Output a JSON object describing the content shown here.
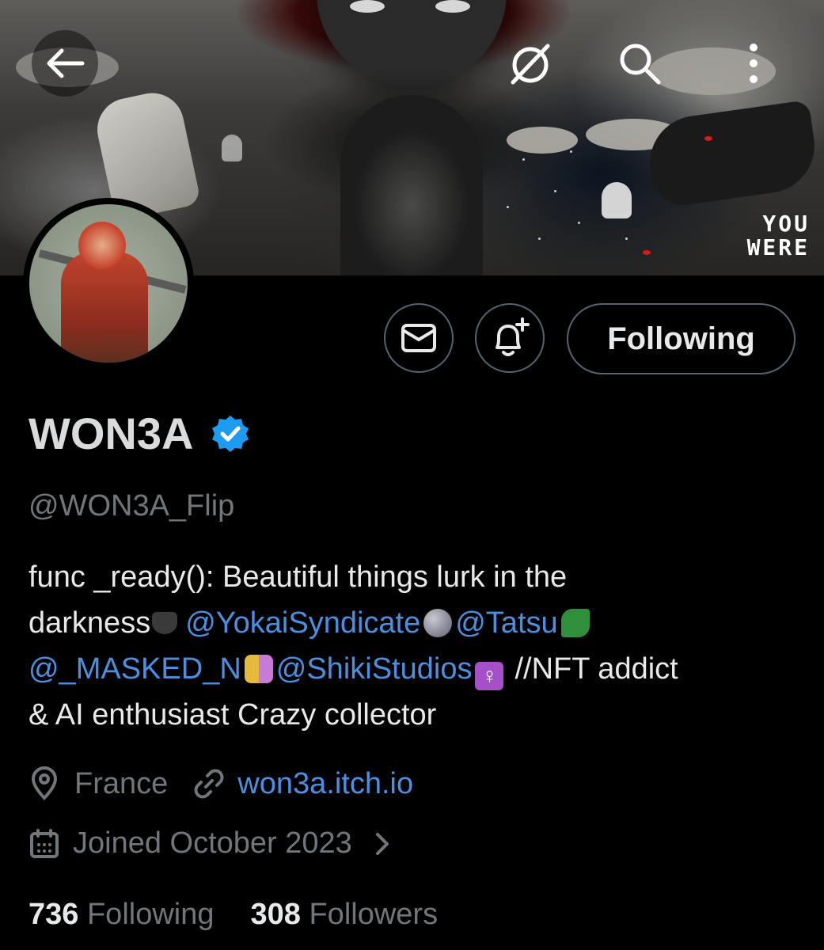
{
  "banner": {
    "text_line1": "YOU",
    "text_line2": "WERE"
  },
  "nav": {
    "back_icon": "arrow-left-icon",
    "grok_icon": "grok-icon",
    "search_icon": "search-icon",
    "more_icon": "more-vertical-icon"
  },
  "actions": {
    "message_icon": "envelope-icon",
    "notify_icon": "bell-plus-icon",
    "following_label": "Following"
  },
  "profile": {
    "name": "WON3A",
    "verified": true,
    "handle": "@WON3A_Flip",
    "bio": {
      "line1": "func _ready(): Beautiful things lurk in the",
      "line2_text": "darkness",
      "mention1": "@YokaiSyndicate",
      "mention2": "@Tatsu",
      "mention3": "@_MASKED_N",
      "mention4": "@ShikiStudios",
      "line3_tail": "//NFT addict",
      "line4": "& AI enthusiast  Crazy collector"
    },
    "location": "France",
    "website": "won3a.itch.io",
    "joined": "Joined October 2023"
  },
  "stats": {
    "following_count": "736",
    "following_label": "Following",
    "followers_count": "308",
    "followers_label": "Followers"
  },
  "colors": {
    "accent": "#4a90e2",
    "verified": "#1d9bf0",
    "muted": "#71767b",
    "border": "#536471"
  }
}
